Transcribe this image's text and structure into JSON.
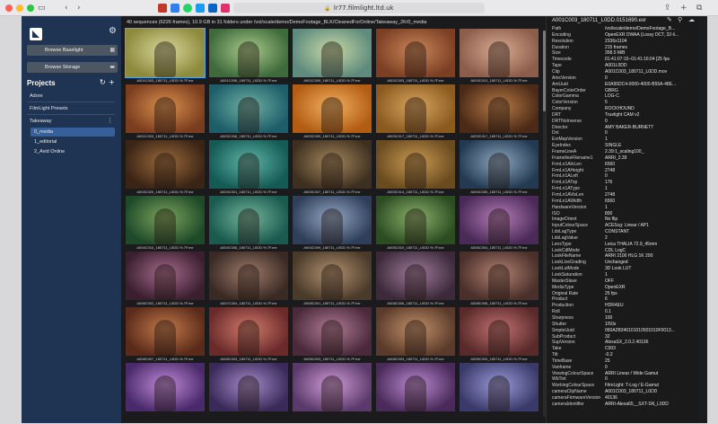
{
  "browser": {
    "url": "lr77.filmlight.ltd.uk",
    "lights": [
      "#ff5f57",
      "#febc2e",
      "#28c840"
    ]
  },
  "sidebar": {
    "browse_baselight": "Browse Baselight",
    "browse_storage": "Browse Storage",
    "projects_label": "Projects",
    "top_items": [
      "Adore",
      "FilmLight Presets"
    ],
    "takeaway": "Takeaway",
    "sub_items": [
      "0_media",
      "1_editorial",
      "2_Avid Online"
    ]
  },
  "main": {
    "header": "40 sequences (6226 frames), 10.9 GB in 31 folders under /vol/scale/demo/DemoFootage_BLK/CleanedForOnline/Takeaway_2K/0_media",
    "rows": [
      {
        "names": [
          "A001C003_180711_L0DD.%.7F.exr",
          "A001C006_180711_L0DD.%.7F.exr",
          "A001C009_180711_L0DD.%.7F.exr",
          "A002C003_180711_L0DD.%.7F.exr",
          "A003C013_180711_L0DD.%.7F.exr"
        ],
        "colors": [
          [
            "#8d8a3d",
            "#d8d79a"
          ],
          [
            "#3f6a3c",
            "#a8c98a"
          ],
          [
            "#5f8b7e",
            "#c7d9a4"
          ],
          [
            "#7c3f23",
            "#c9865a"
          ],
          [
            "#8c5d4a",
            "#d8aa91"
          ]
        ]
      },
      {
        "names": [
          "A001C003_180711_L0DD.%.7F.exr",
          "A003C008_180711_L0DD.%.7F.exr",
          "A003C009_180711_L0DD.%.7F.exr",
          "A003C017_180711_L0DD.%.7F.exr",
          "A003C017_180711_L0DD.%.7F.exr"
        ],
        "colors": [
          [
            "#7b3d1f",
            "#d88f4c"
          ],
          [
            "#1d5e6a",
            "#6fb0a3"
          ],
          [
            "#b35d14",
            "#f0b060"
          ],
          [
            "#8a5a1f",
            "#d9a560"
          ],
          [
            "#4c2a17",
            "#b57a45"
          ]
        ]
      },
      {
        "names": [
          "A003C020_180711_L0DD.%.7F.exr",
          "A004C001_180711_L0DD.%.7F.exr",
          "A003C007_180711_L0DD.%.7F.exr",
          "A003C014_180711_L0DD.%.7F.exr",
          "A004C005_180711_L0DD.%.7F.exr"
        ],
        "colors": [
          [
            "#3a2415",
            "#9a6a3a"
          ],
          [
            "#145a55",
            "#5fb3a5"
          ],
          [
            "#3e3020",
            "#a3865c"
          ],
          [
            "#6a4a1f",
            "#c79a52"
          ],
          [
            "#233a52",
            "#8ca7bf"
          ]
        ]
      },
      {
        "names": [
          "A004C010_180711_L0DD.%.7F.exr",
          "A004C006_180711_L0DD.%.7F.exr",
          "A004C009_180711_L0DD.%.7F.exr",
          "A005C010_180711_L0DD.%.7F.exr",
          "A006C004_180711_L0DD.%.7F.exr"
        ],
        "colors": [
          [
            "#1f4a2a",
            "#7ba35a"
          ],
          [
            "#1a5a4f",
            "#72b39a"
          ],
          [
            "#2f3f5a",
            "#93a6c2"
          ],
          [
            "#2c4c22",
            "#8ab06a"
          ],
          [
            "#4a2a57",
            "#b27ab5"
          ]
        ]
      },
      {
        "names": [
          "A006C002_180711_L0DD.%.7F.exr",
          "A007C004_180711_L0DD.%.7F.exr",
          "A008C001_180711_L0DD.%.7F.exr",
          "A008C006_180711_L0DD.%.7F.exr",
          "A008C008_180711_L0DD.%.7F.exr"
        ],
        "colors": [
          [
            "#3a1f2f",
            "#a56a8c"
          ],
          [
            "#3a2a24",
            "#9c7a6a"
          ],
          [
            "#4a3a2a",
            "#b0906e"
          ],
          [
            "#3c2a3a",
            "#9e7a9a"
          ],
          [
            "#4a2f2a",
            "#b08070"
          ]
        ]
      },
      {
        "names": [
          "A008C007_180711_L0DD.%.7F.exr",
          "A008C003_180711_L0DD.%.7F.exr",
          "A008C003_180711_L0DD.%.7F.exr",
          "A008C003_180711_L0DD.%.7F.exr",
          "A008C003_180711_L0DD.%.7F.exr"
        ],
        "colors": [
          [
            "#5a2a1a",
            "#c27a4a"
          ],
          [
            "#6a2a2a",
            "#d07a6a"
          ],
          [
            "#4a2a3a",
            "#b07a95"
          ],
          [
            "#5a3a2a",
            "#c0906a"
          ],
          [
            "#5a2a2a",
            "#c07070"
          ]
        ]
      },
      {
        "names": [
          "",
          "",
          "",
          "",
          ""
        ],
        "colors": [
          [
            "#4a2a6a",
            "#c08ad8"
          ],
          [
            "#3a2a5a",
            "#a58ac8"
          ],
          [
            "#5a3a6a",
            "#d09ad8"
          ],
          [
            "#4a2a5a",
            "#b98ad0"
          ],
          [
            "#3a3a6a",
            "#9a9ad8"
          ]
        ]
      }
    ]
  },
  "info": {
    "title": "A001C003_180711_L0DD.0151690.exr",
    "rows": [
      [
        "Path",
        "/vol/scale/demo/DemoFootage_B..."
      ],
      [
        "Encoding",
        "OpenEXR DWAA (Lossy DCT, 32-li..."
      ],
      [
        "Resolution",
        "2336x1104"
      ],
      [
        "Duration",
        "215 frames"
      ],
      [
        "Size",
        "358.5 MiB"
      ],
      [
        "Timecode",
        "01:41:07:15–01:41:16:04 [25 fps"
      ],
      [
        "Tape",
        "A001L0DD"
      ],
      [
        "Clip",
        "A001C003_180711_L0DD.mov"
      ],
      [
        "AmcVersion",
        "0"
      ],
      [
        "AmUuid",
        "E0A95DC4-0000-4000-B55A-48E..."
      ],
      [
        "BayerColorOrder",
        "GBRG"
      ],
      [
        "ColorGamma",
        "LOG-C"
      ],
      [
        "ColorVersion",
        "5"
      ],
      [
        "Company",
        "ROCKHOUND"
      ],
      [
        "DRT",
        "Truelight CAM v2"
      ],
      [
        "DRTNoInverse",
        "0"
      ],
      [
        "Director",
        "AMY BAKER-BURNETT"
      ],
      [
        "Dol",
        "0"
      ],
      [
        "ExrMapVersion",
        "1"
      ],
      [
        "EyeIndex",
        "SINGLE"
      ],
      [
        "FrameLineA",
        "2.39:1_scaling100_"
      ],
      [
        "FramelineFilename1",
        "ARRI_2.39"
      ],
      [
        "FrmLn1AlnLen",
        "6560"
      ],
      [
        "FrmLn1AHeight",
        "2748"
      ],
      [
        "FrmLn1ALeft",
        "0"
      ],
      [
        "FrmLn1ATop",
        "176"
      ],
      [
        "FrmLn1AType",
        "1"
      ],
      [
        "FrmLn1AVisLen",
        "2748"
      ],
      [
        "FrmLn1AWidth",
        "6560"
      ],
      [
        "HardwareVersion",
        "1"
      ],
      [
        "ISO",
        "800"
      ],
      [
        "ImageOrient",
        "No flip"
      ],
      [
        "InputColourSpace",
        "ACEScg: Linear / AP1"
      ],
      [
        "LdsLagType",
        "CONSTANT"
      ],
      [
        "LdsLagValue",
        "2"
      ],
      [
        "LensType",
        "Leica THALIA 72.9_45mm"
      ],
      [
        "LookCdlMode",
        "CDL LogC"
      ],
      [
        "LookFileName",
        "ARRI 2100 HLG 1K 200"
      ],
      [
        "LookLiveGrading",
        "Unchanged"
      ],
      [
        "LookLutMode",
        "3D Look LUT"
      ],
      [
        "LookSaturation",
        "1"
      ],
      [
        "MasterSlave",
        "OFF"
      ],
      [
        "MediaType",
        "OpenEXR"
      ],
      [
        "Original Rate",
        "25 fps"
      ],
      [
        "Product",
        "6"
      ],
      [
        "Production",
        "HDR4EU"
      ],
      [
        "Roll",
        "0.1"
      ],
      [
        "Sharpness",
        "100"
      ],
      [
        "Shutter",
        "1/50s"
      ],
      [
        "SmpteUuid",
        "060A2B340101010501010F0013..."
      ],
      [
        "SubProduct",
        "32"
      ],
      [
        "SupVersion",
        "AlexaSX_2.0.2.40136"
      ],
      [
        "Take",
        "C003"
      ],
      [
        "Tilt",
        "-0.2"
      ],
      [
        "TimeBase",
        "25"
      ],
      [
        "Vanframe",
        "0"
      ],
      [
        "ViewingColourSpace",
        "ARRI Linear / Wide Gamut"
      ],
      [
        "WbTint",
        "0"
      ],
      [
        "WorkingColourSpace",
        "FilmLight: T-Log / E-Gamut"
      ],
      [
        "cameraClipName",
        "A001C003_180711_L0DD"
      ],
      [
        "cameraFirmwareVersion",
        "40136"
      ],
      [
        "cameraIdentifier",
        "ARRI-Alexa65__SXT-SN_L0DD"
      ],
      [
        "",
        ""
      ]
    ]
  }
}
